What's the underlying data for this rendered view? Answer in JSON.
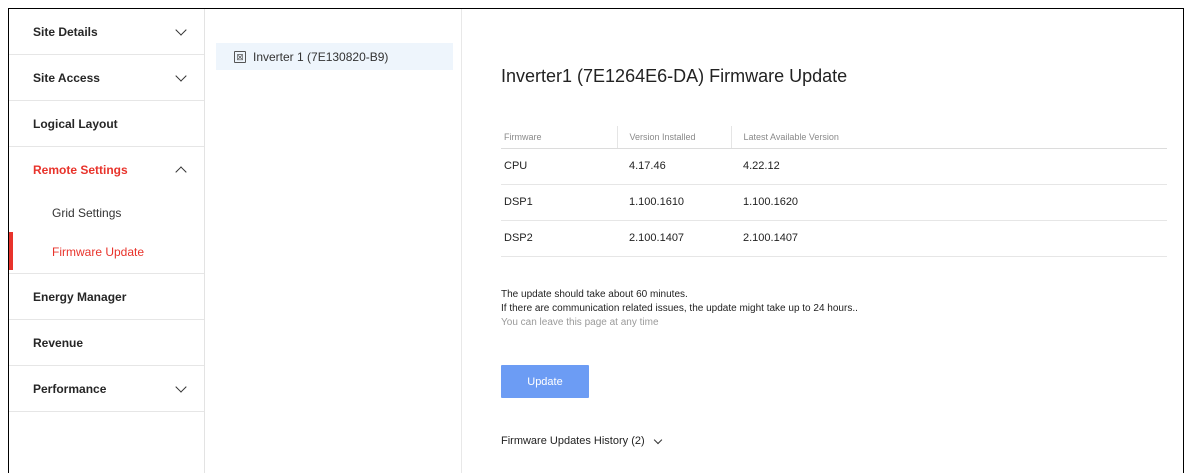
{
  "sidebar": {
    "items": [
      {
        "label": "Site Details",
        "chevron": "down"
      },
      {
        "label": "Site Access",
        "chevron": "down"
      },
      {
        "label": "Logical Layout"
      },
      {
        "label": "Remote Settings",
        "chevron": "up",
        "active": true,
        "children": [
          {
            "label": "Grid Settings"
          },
          {
            "label": "Firmware Update",
            "active": true
          }
        ]
      },
      {
        "label": "Energy Manager"
      },
      {
        "label": "Revenue"
      },
      {
        "label": "Performance",
        "chevron": "down"
      }
    ]
  },
  "tree": {
    "selected_icon": "inverter-icon",
    "selected_label": "Inverter 1 (7E130820-B9)"
  },
  "main": {
    "title": "Inverter1 (7E1264E6-DA) Firmware Update",
    "table": {
      "headers": [
        "Firmware",
        "Version Installed",
        "Latest Available Version"
      ],
      "rows": [
        [
          "CPU",
          "4.17.46",
          "4.22.12"
        ],
        [
          "DSP1",
          "1.100.1610",
          "1.100.1620"
        ],
        [
          "DSP2",
          "2.100.1407",
          "2.100.1407"
        ]
      ]
    },
    "info_line1": "The update should take about 60 minutes.",
    "info_line2": "If there are communication related issues, the update might take up to 24 hours..",
    "info_line3": "You can leave this page at any time",
    "update_button": "Update",
    "history_label": "Firmware Updates History (2)"
  },
  "colors": {
    "accent_red": "#e8332b",
    "button_blue": "#6c9cf4",
    "tree_selected_bg": "#eef5fc"
  }
}
